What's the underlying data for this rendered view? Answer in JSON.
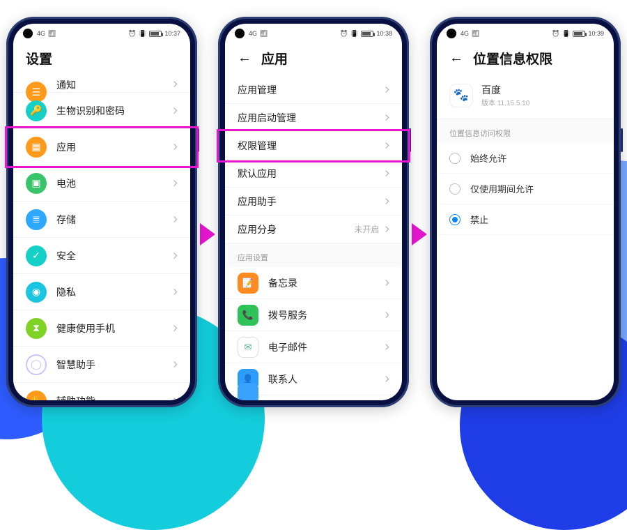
{
  "colors": {
    "orange": "#ff9a1a",
    "green": "#39c46b",
    "blue": "#2ea8ff",
    "cyan": "#15d0c7",
    "teal": "#1bc5e0",
    "purple": "#0fb7c7",
    "red": "#ff5a3d",
    "lime": "#7fd324",
    "appOrange": "#ff8a1f",
    "appGreen": "#2ec259",
    "appBlue": "#2c9cff",
    "appCyan": "#3aa1ff"
  },
  "screen1": {
    "time": "10:37",
    "net": "4G",
    "title": "设置",
    "items": [
      {
        "label": "通知",
        "color": "#ff9a1a",
        "glyph": "☰",
        "cut": true
      },
      {
        "label": "生物识别和密码",
        "color": "#15d0c7",
        "glyph": "🔑"
      },
      {
        "label": "应用",
        "color": "#ff9a1a",
        "glyph": "▦",
        "highlight": true
      },
      {
        "label": "电池",
        "color": "#39c46b",
        "glyph": "▣"
      },
      {
        "label": "存储",
        "color": "#2ea8ff",
        "glyph": "≣"
      },
      {
        "label": "安全",
        "color": "#15d0c7",
        "glyph": "✓"
      },
      {
        "label": "隐私",
        "color": "#1bc5e0",
        "glyph": "◉"
      },
      {
        "label": "健康使用手机",
        "color": "#7fd324",
        "glyph": "⧗"
      },
      {
        "label": "智慧助手",
        "color": "#ffffff",
        "glyph": "◯",
        "ring": true
      },
      {
        "label": "辅助功能",
        "color": "#ff9a1a",
        "glyph": "✋"
      },
      {
        "label": "",
        "color": "#ff5a3d",
        "glyph": "",
        "cutBottom": true
      }
    ]
  },
  "screen2": {
    "time": "10:38",
    "net": "4G",
    "title": "应用",
    "section1": [
      {
        "label": "应用管理"
      },
      {
        "label": "应用启动管理"
      },
      {
        "label": "权限管理",
        "highlight": true
      },
      {
        "label": "默认应用"
      },
      {
        "label": "应用助手"
      },
      {
        "label": "应用分身",
        "value": "未开启"
      }
    ],
    "sectionHeader": "应用设置",
    "apps": [
      {
        "label": "备忘录",
        "color": "#ff8a1f",
        "glyph": "📝"
      },
      {
        "label": "拨号服务",
        "color": "#2ec259",
        "glyph": "📞"
      },
      {
        "label": "电子邮件",
        "color": "#ffffff",
        "glyph": "✉",
        "ring": true
      },
      {
        "label": "联系人",
        "color": "#2c9cff",
        "glyph": "👤"
      },
      {
        "label": "",
        "color": "#3aa1ff",
        "glyph": "",
        "cutBottom": true
      }
    ]
  },
  "screen3": {
    "time": "10:39",
    "net": "4G",
    "title": "位置信息权限",
    "app": {
      "name": "百度",
      "version": "版本 11.15.5.10",
      "glyph": "🐾"
    },
    "sectionHeader": "位置信息访问权限",
    "options": [
      {
        "label": "始终允许",
        "checked": false
      },
      {
        "label": "仅使用期间允许",
        "checked": false
      },
      {
        "label": "禁止",
        "checked": true
      }
    ]
  }
}
